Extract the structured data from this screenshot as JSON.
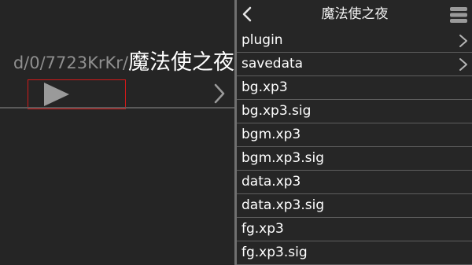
{
  "left_pane": {
    "path_prefix": "d/0/7723KrKr/",
    "path_current": "魔法使之夜"
  },
  "right_pane": {
    "title": "魔法使之夜",
    "files": [
      {
        "name": "plugin",
        "is_folder": true
      },
      {
        "name": "savedata",
        "is_folder": true
      },
      {
        "name": "bg.xp3",
        "is_folder": false
      },
      {
        "name": "bg.xp3.sig",
        "is_folder": false
      },
      {
        "name": "bgm.xp3",
        "is_folder": false
      },
      {
        "name": "bgm.xp3.sig",
        "is_folder": false
      },
      {
        "name": "data.xp3",
        "is_folder": false
      },
      {
        "name": "data.xp3.sig",
        "is_folder": false
      },
      {
        "name": "fg.xp3",
        "is_folder": false
      },
      {
        "name": "fg.xp3.sig",
        "is_folder": false
      }
    ]
  },
  "icons": {
    "play": "play-icon",
    "forward": "chevron-right-icon",
    "back": "chevron-left-icon",
    "menu": "menu-icon"
  },
  "colors": {
    "background": "#252525",
    "highlight_box": "#d21a1a",
    "path_gray": "#8f8f8f",
    "icon_gray": "#9a9a9a"
  }
}
